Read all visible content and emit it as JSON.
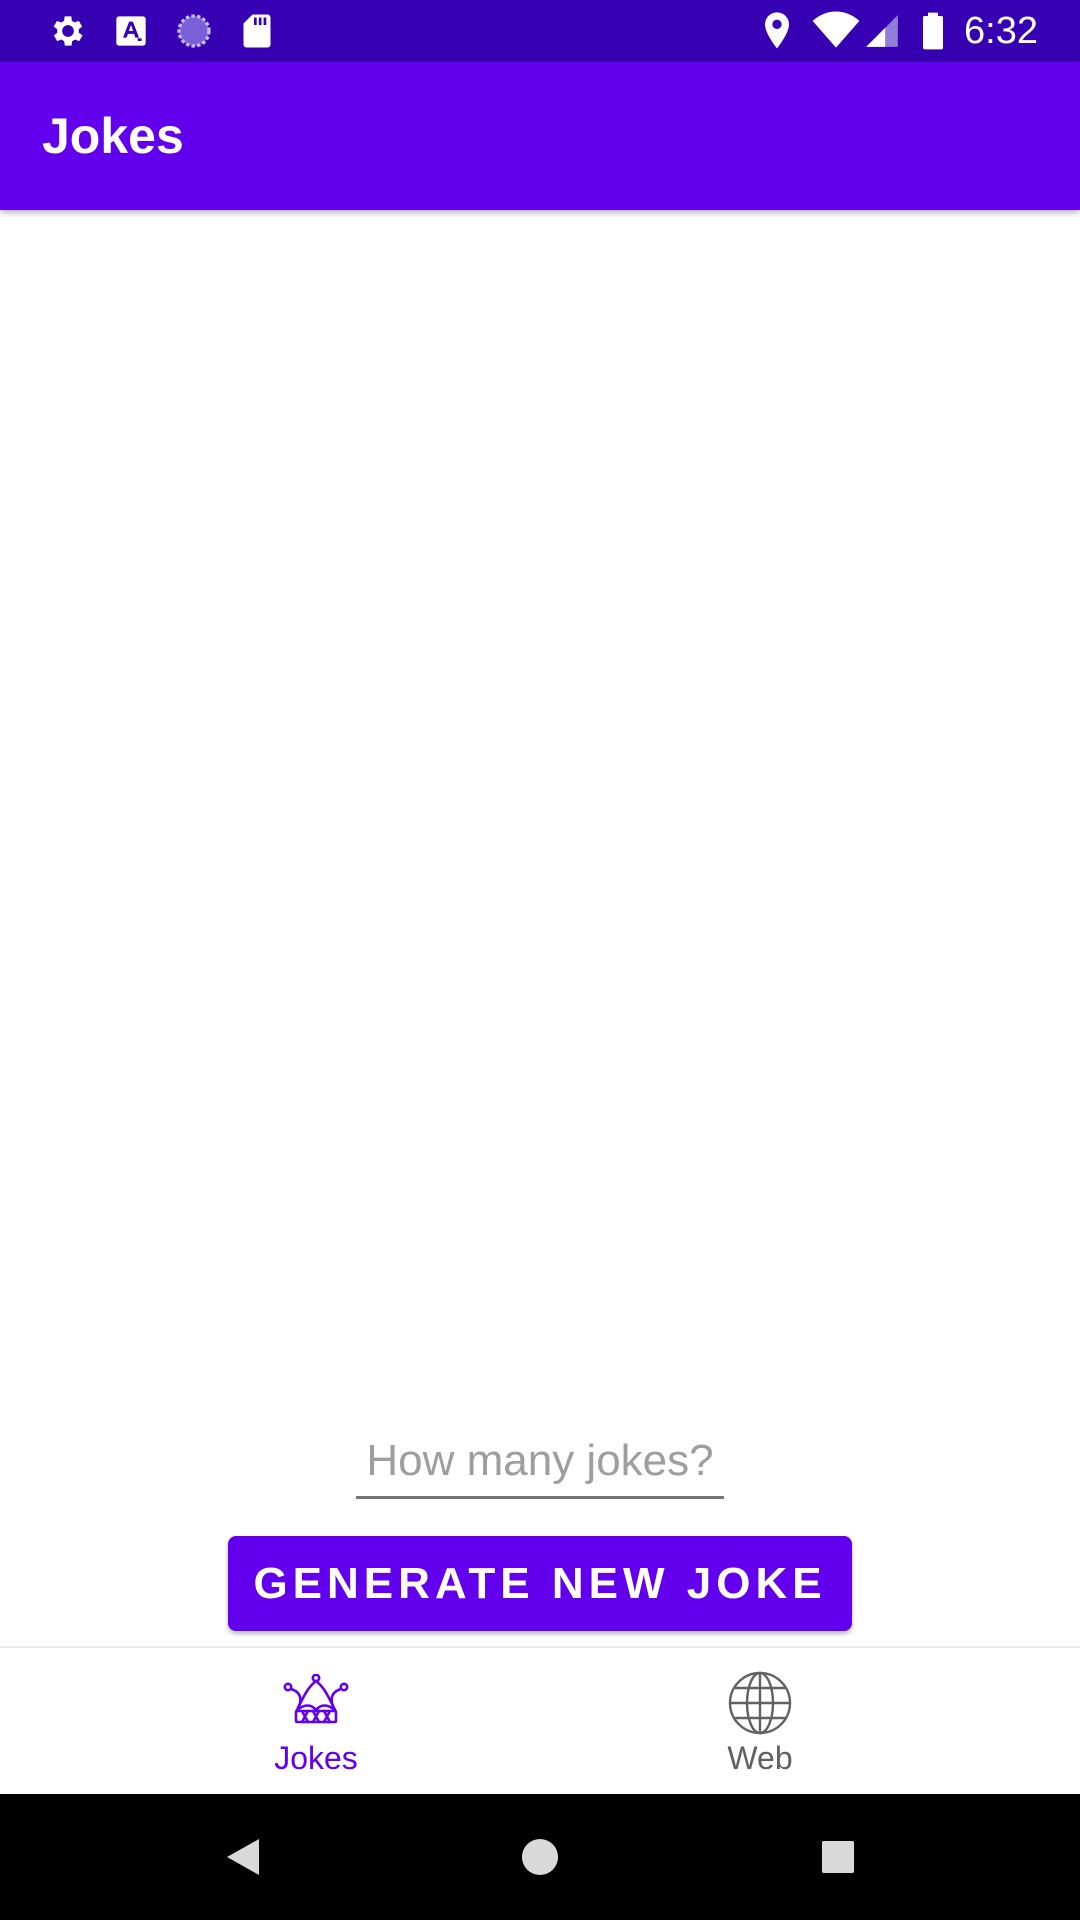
{
  "status_bar": {
    "time": "6:32",
    "left_icons": [
      "gear-icon",
      "font-a-icon",
      "sync-circle-icon",
      "sd-card-icon"
    ],
    "right_icons": [
      "location-icon",
      "wifi-icon",
      "signal-icon",
      "battery-icon"
    ]
  },
  "app_bar": {
    "title": "Jokes"
  },
  "main": {
    "jokes_input": {
      "value": "",
      "placeholder": "How many jokes?"
    },
    "generate_button_label": "GENERATE NEW JOKE"
  },
  "bottom_nav": {
    "items": [
      {
        "label": "Jokes",
        "icon": "jester-hat-icon",
        "selected": true
      },
      {
        "label": "Web",
        "icon": "globe-icon",
        "selected": false
      }
    ]
  },
  "system_nav": {
    "buttons": [
      "back-icon",
      "home-icon",
      "recents-icon"
    ]
  },
  "colors": {
    "status_bar": "#3700B3",
    "primary": "#6200EE",
    "nav_inactive": "#616161",
    "system_nav": "#000000"
  }
}
